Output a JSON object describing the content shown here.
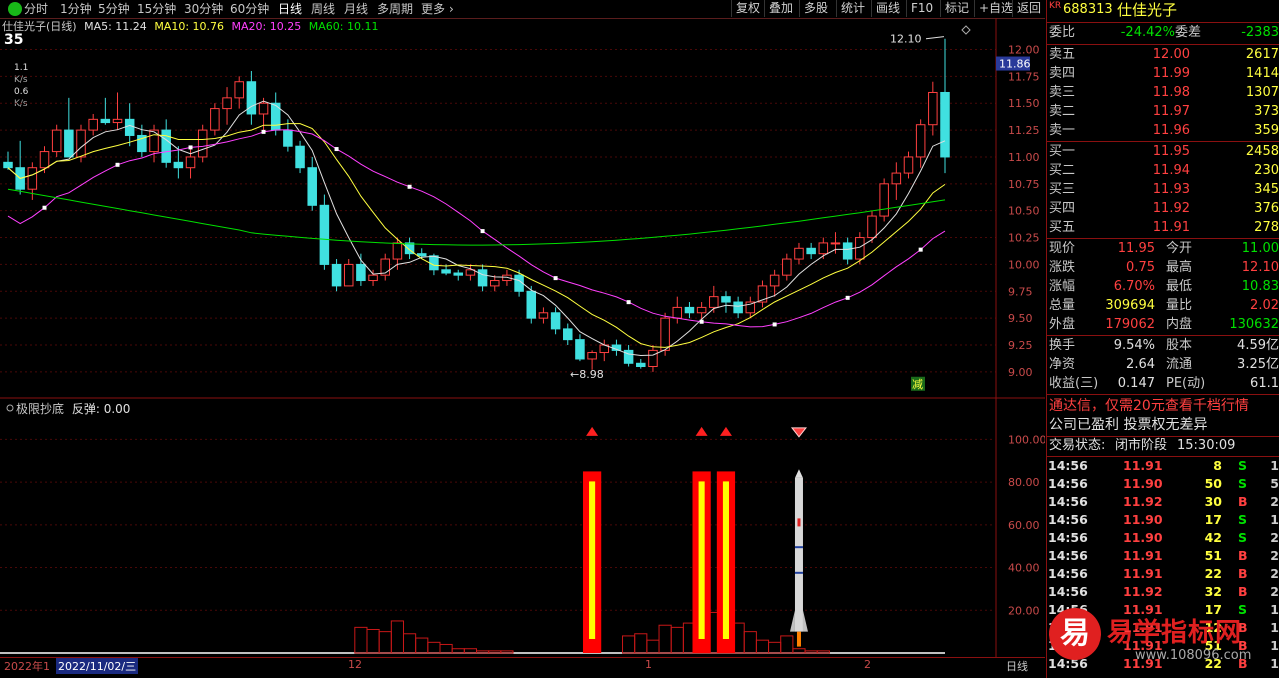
{
  "toolbar": {
    "periods": [
      "分时",
      "1分钟",
      "5分钟",
      "15分钟",
      "30分钟",
      "60分钟",
      "日线",
      "周线",
      "月线",
      "多周期",
      "更多"
    ],
    "active_period": "日线",
    "buttons": [
      "复权",
      "叠加",
      "多股",
      "统计",
      "画线",
      "F10",
      "标记",
      "+自选",
      "返回"
    ]
  },
  "chart_header": {
    "title": "仕佳光子(日线)",
    "ma5": "MA5: 11.24",
    "ma10": "MA10: 10.76",
    "ma20": "MA20: 10.25",
    "ma60": "MA60: 10.11"
  },
  "left_badges": {
    "score": "35",
    "v1": "1.1",
    "v1u": "K/s",
    "v2": "0.6",
    "v2u": "K/s"
  },
  "price_axis": {
    "current_price_tag": "11.86",
    "labels": [
      "12.00",
      "11.75",
      "11.50",
      "11.25",
      "11.00",
      "10.75",
      "10.50",
      "10.25",
      "10.00",
      "9.75",
      "9.50",
      "9.25",
      "9.00"
    ],
    "high_label": "12.10",
    "low_label": "8.98",
    "reduce_marker": "减"
  },
  "indicator": {
    "title": "极限抄底",
    "sub": "反弹: 0.00",
    "labels": [
      "100.00",
      "80.00",
      "60.00",
      "40.00",
      "20.00"
    ]
  },
  "date_axis": {
    "year_label": "2022年1",
    "cursor_date": "2022/11/02/三",
    "months": [
      "12",
      "1",
      "2"
    ],
    "right_label": "日线"
  },
  "colors": {
    "up": "#ff4040",
    "down": "#40e0e0",
    "ma5": "#e0e0e0",
    "ma10": "#ffff40",
    "ma20": "#ff40ff",
    "ma60": "#00e000"
  },
  "chart_data": {
    "type": "candlestick",
    "ylim": [
      8.85,
      12.2
    ],
    "candles": [
      [
        10.95,
        11.05,
        10.88,
        10.9
      ],
      [
        10.9,
        11.15,
        10.65,
        10.7
      ],
      [
        10.7,
        10.95,
        10.6,
        10.9
      ],
      [
        10.9,
        11.1,
        10.85,
        11.05
      ],
      [
        11.05,
        11.3,
        11.0,
        11.25
      ],
      [
        11.25,
        11.55,
        11.1,
        11.0
      ],
      [
        11.0,
        11.3,
        10.95,
        11.25
      ],
      [
        11.25,
        11.4,
        11.2,
        11.35
      ],
      [
        11.35,
        11.55,
        11.3,
        11.32
      ],
      [
        11.32,
        11.6,
        11.25,
        11.35
      ],
      [
        11.35,
        11.5,
        11.1,
        11.2
      ],
      [
        11.2,
        11.3,
        11.0,
        11.05
      ],
      [
        11.05,
        11.3,
        10.95,
        11.25
      ],
      [
        11.25,
        11.35,
        10.9,
        10.95
      ],
      [
        10.95,
        11.1,
        10.8,
        10.9
      ],
      [
        10.9,
        11.1,
        10.8,
        11.0
      ],
      [
        11.0,
        11.3,
        10.95,
        11.25
      ],
      [
        11.25,
        11.5,
        11.2,
        11.45
      ],
      [
        11.45,
        11.65,
        11.3,
        11.55
      ],
      [
        11.55,
        11.75,
        11.45,
        11.7
      ],
      [
        11.7,
        11.8,
        11.3,
        11.4
      ],
      [
        11.4,
        11.55,
        11.25,
        11.5
      ],
      [
        11.5,
        11.6,
        11.2,
        11.25
      ],
      [
        11.25,
        11.35,
        11.05,
        11.1
      ],
      [
        11.1,
        11.15,
        10.85,
        10.9
      ],
      [
        10.9,
        11.0,
        10.5,
        10.55
      ],
      [
        10.55,
        10.65,
        9.95,
        10.0
      ],
      [
        10.0,
        10.05,
        9.75,
        9.8
      ],
      [
        9.8,
        10.05,
        9.8,
        10.0
      ],
      [
        10.0,
        10.1,
        9.8,
        9.85
      ],
      [
        9.85,
        9.95,
        9.8,
        9.9
      ],
      [
        9.9,
        10.1,
        9.85,
        10.05
      ],
      [
        10.05,
        10.25,
        9.95,
        10.2
      ],
      [
        10.2,
        10.25,
        10.05,
        10.1
      ],
      [
        10.1,
        10.15,
        10.05,
        10.08
      ],
      [
        10.08,
        10.1,
        9.9,
        9.95
      ],
      [
        9.95,
        10.0,
        9.9,
        9.92
      ],
      [
        9.92,
        9.95,
        9.85,
        9.9
      ],
      [
        9.9,
        10.0,
        9.85,
        9.95
      ],
      [
        9.95,
        10.0,
        9.75,
        9.8
      ],
      [
        9.8,
        9.9,
        9.75,
        9.85
      ],
      [
        9.85,
        9.95,
        9.8,
        9.9
      ],
      [
        9.9,
        9.95,
        9.7,
        9.75
      ],
      [
        9.75,
        9.8,
        9.45,
        9.5
      ],
      [
        9.5,
        9.6,
        9.45,
        9.55
      ],
      [
        9.55,
        9.6,
        9.35,
        9.4
      ],
      [
        9.4,
        9.45,
        9.25,
        9.3
      ],
      [
        9.3,
        9.35,
        9.1,
        9.12
      ],
      [
        9.12,
        9.2,
        9.02,
        9.18
      ],
      [
        9.18,
        9.3,
        9.1,
        9.25
      ],
      [
        9.25,
        9.3,
        9.15,
        9.2
      ],
      [
        9.2,
        9.25,
        9.05,
        9.08
      ],
      [
        9.08,
        9.12,
        9.03,
        9.05
      ],
      [
        9.05,
        9.25,
        9.0,
        9.2
      ],
      [
        9.2,
        9.55,
        9.15,
        9.5
      ],
      [
        9.5,
        9.7,
        9.45,
        9.6
      ],
      [
        9.6,
        9.65,
        9.5,
        9.55
      ],
      [
        9.55,
        9.65,
        9.45,
        9.6
      ],
      [
        9.6,
        9.8,
        9.55,
        9.7
      ],
      [
        9.7,
        9.75,
        9.55,
        9.65
      ],
      [
        9.65,
        9.7,
        9.5,
        9.55
      ],
      [
        9.55,
        9.7,
        9.5,
        9.65
      ],
      [
        9.65,
        9.85,
        9.6,
        9.8
      ],
      [
        9.8,
        9.95,
        9.7,
        9.9
      ],
      [
        9.9,
        10.1,
        9.85,
        10.05
      ],
      [
        10.05,
        10.2,
        10.0,
        10.15
      ],
      [
        10.15,
        10.2,
        10.05,
        10.1
      ],
      [
        10.1,
        10.25,
        10.05,
        10.2
      ],
      [
        10.2,
        10.3,
        10.1,
        10.2
      ],
      [
        10.2,
        10.25,
        10.0,
        10.05
      ],
      [
        10.05,
        10.3,
        10.0,
        10.25
      ],
      [
        10.25,
        10.5,
        10.2,
        10.45
      ],
      [
        10.45,
        10.8,
        10.4,
        10.75
      ],
      [
        10.75,
        10.95,
        10.6,
        10.85
      ],
      [
        10.85,
        11.05,
        10.8,
        11.0
      ],
      [
        11.0,
        11.35,
        10.9,
        11.3
      ],
      [
        11.3,
        11.7,
        11.2,
        11.6
      ],
      [
        11.6,
        12.1,
        10.85,
        11.0
      ]
    ],
    "indicator_bars": []
  },
  "right_panel": {
    "code": "688313",
    "name": "仕佳光子",
    "kr": "KR",
    "weibi_label": "委比",
    "weibi": "-24.42%",
    "weicha_label": "委差",
    "weicha": "-2383",
    "sells": [
      {
        "label": "卖五",
        "price": "12.00",
        "vol": "2617"
      },
      {
        "label": "卖四",
        "price": "11.99",
        "vol": "1414"
      },
      {
        "label": "卖三",
        "price": "11.98",
        "vol": "1307"
      },
      {
        "label": "卖二",
        "price": "11.97",
        "vol": "373"
      },
      {
        "label": "卖一",
        "price": "11.96",
        "vol": "359"
      }
    ],
    "buys": [
      {
        "label": "买一",
        "price": "11.95",
        "vol": "2458"
      },
      {
        "label": "买二",
        "price": "11.94",
        "vol": "230"
      },
      {
        "label": "买三",
        "price": "11.93",
        "vol": "345"
      },
      {
        "label": "买四",
        "price": "11.92",
        "vol": "376"
      },
      {
        "label": "买五",
        "price": "11.91",
        "vol": "278"
      }
    ],
    "quote": [
      {
        "a": "现价",
        "b": "11.95",
        "bc": "red",
        "c": "今开",
        "d": "11.00",
        "dc": "grn"
      },
      {
        "a": "涨跌",
        "b": "0.75",
        "bc": "red",
        "c": "最高",
        "d": "12.10",
        "dc": "red"
      },
      {
        "a": "涨幅",
        "b": "6.70%",
        "bc": "red",
        "c": "最低",
        "d": "10.83",
        "dc": "grn"
      },
      {
        "a": "总量",
        "b": "309694",
        "bc": "yel",
        "c": "量比",
        "d": "2.02",
        "dc": "red"
      },
      {
        "a": "外盘",
        "b": "179062",
        "bc": "red",
        "c": "内盘",
        "d": "130632",
        "dc": "grn"
      }
    ],
    "fund": [
      {
        "a": "换手",
        "b": "9.54%",
        "c": "股本",
        "d": "4.59亿"
      },
      {
        "a": "净资",
        "b": "2.64",
        "c": "流通",
        "d": "3.25亿"
      },
      {
        "a": "收益(三)",
        "b": "0.147",
        "c": "PE(动)",
        "d": "61.1"
      }
    ],
    "notice1": "通达信，仅需20元查看千档行情",
    "notice2": "公司已盈利 投票权无差异",
    "status_label": "交易状态:",
    "status_value": "闭市阶段",
    "status_time": "15:30:09",
    "trades": [
      {
        "t": "14:56",
        "p": "11.91",
        "pc": "red",
        "v": "8",
        "s": "S",
        "sc": "grn",
        "x": "1"
      },
      {
        "t": "14:56",
        "p": "11.90",
        "pc": "red",
        "v": "50",
        "s": "S",
        "sc": "grn",
        "x": "5"
      },
      {
        "t": "14:56",
        "p": "11.92",
        "pc": "red",
        "v": "30",
        "s": "B",
        "sc": "red",
        "x": "2"
      },
      {
        "t": "14:56",
        "p": "11.90",
        "pc": "red",
        "v": "17",
        "s": "S",
        "sc": "grn",
        "x": "1"
      },
      {
        "t": "14:56",
        "p": "11.90",
        "pc": "red",
        "v": "42",
        "s": "S",
        "sc": "grn",
        "x": "2"
      },
      {
        "t": "14:56",
        "p": "11.91",
        "pc": "red",
        "v": "51",
        "s": "B",
        "sc": "red",
        "x": "2"
      },
      {
        "t": "14:56",
        "p": "11.91",
        "pc": "red",
        "v": "22",
        "s": "B",
        "sc": "red",
        "x": "2"
      },
      {
        "t": "14:56",
        "p": "11.92",
        "pc": "red",
        "v": "32",
        "s": "B",
        "sc": "red",
        "x": "2"
      },
      {
        "t": "14:56",
        "p": "11.91",
        "pc": "red",
        "v": "17",
        "s": "S",
        "sc": "grn",
        "x": "1"
      },
      {
        "t": "14:56",
        "p": "11.91",
        "pc": "red",
        "v": "12",
        "s": "B",
        "sc": "red",
        "x": "1"
      },
      {
        "t": "14:56",
        "p": "11.91",
        "pc": "red",
        "v": "51",
        "s": "B",
        "sc": "red",
        "x": "1"
      },
      {
        "t": "14:56",
        "p": "11.91",
        "pc": "red",
        "v": "22",
        "s": "B",
        "sc": "red",
        "x": "1"
      }
    ],
    "watermark_glyph": "易",
    "watermark_text": "易学指标网",
    "watermark_url": "www.108096.com"
  }
}
